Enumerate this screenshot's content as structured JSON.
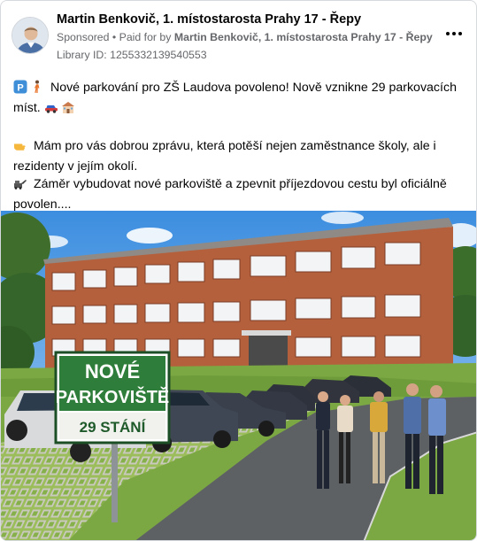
{
  "post": {
    "author": "Martin Benkovič, 1. místostarosta Prahy 17 - Řepy",
    "sponsored_label": "Sponsored",
    "separator": "•",
    "paid_for_prefix": "Paid for by",
    "paid_for_by": "Martin Benkovič, 1. místostarosta Prahy 17 - Řepy",
    "library_id": "Library ID: 1255332139540553",
    "paragraph1_line1": "Nové parkování pro ZŠ Laudova povoleno! Nově vznikne 29 parkovacích",
    "paragraph1_line2": "míst.",
    "paragraph2_line1": "Mám pro vás dobrou zprávu, která potěší nejen zaměstnance školy, ale i",
    "paragraph2_line2": "rezidenty v jejím okolí.",
    "paragraph3_line1": "Záměr vybudovat nové parkoviště a zpevnit příjezdovou cestu byl oficiálně",
    "paragraph3_line2": "povolen...."
  },
  "image": {
    "sign_line1": "NOVÉ",
    "sign_line2": "PARKOVIŠTĚ",
    "sign_line3": "29 STÁNÍ"
  },
  "icons": [
    "avatar",
    "more-options-icon",
    "parking-sign-icon",
    "pedestrian-icon",
    "car-icon",
    "school-icon",
    "pointing-hand-icon",
    "construction-icon"
  ],
  "colors": {
    "secondary_text": "#65676b",
    "sign_green": "#2f7d3a",
    "brick": "#b5603c"
  }
}
